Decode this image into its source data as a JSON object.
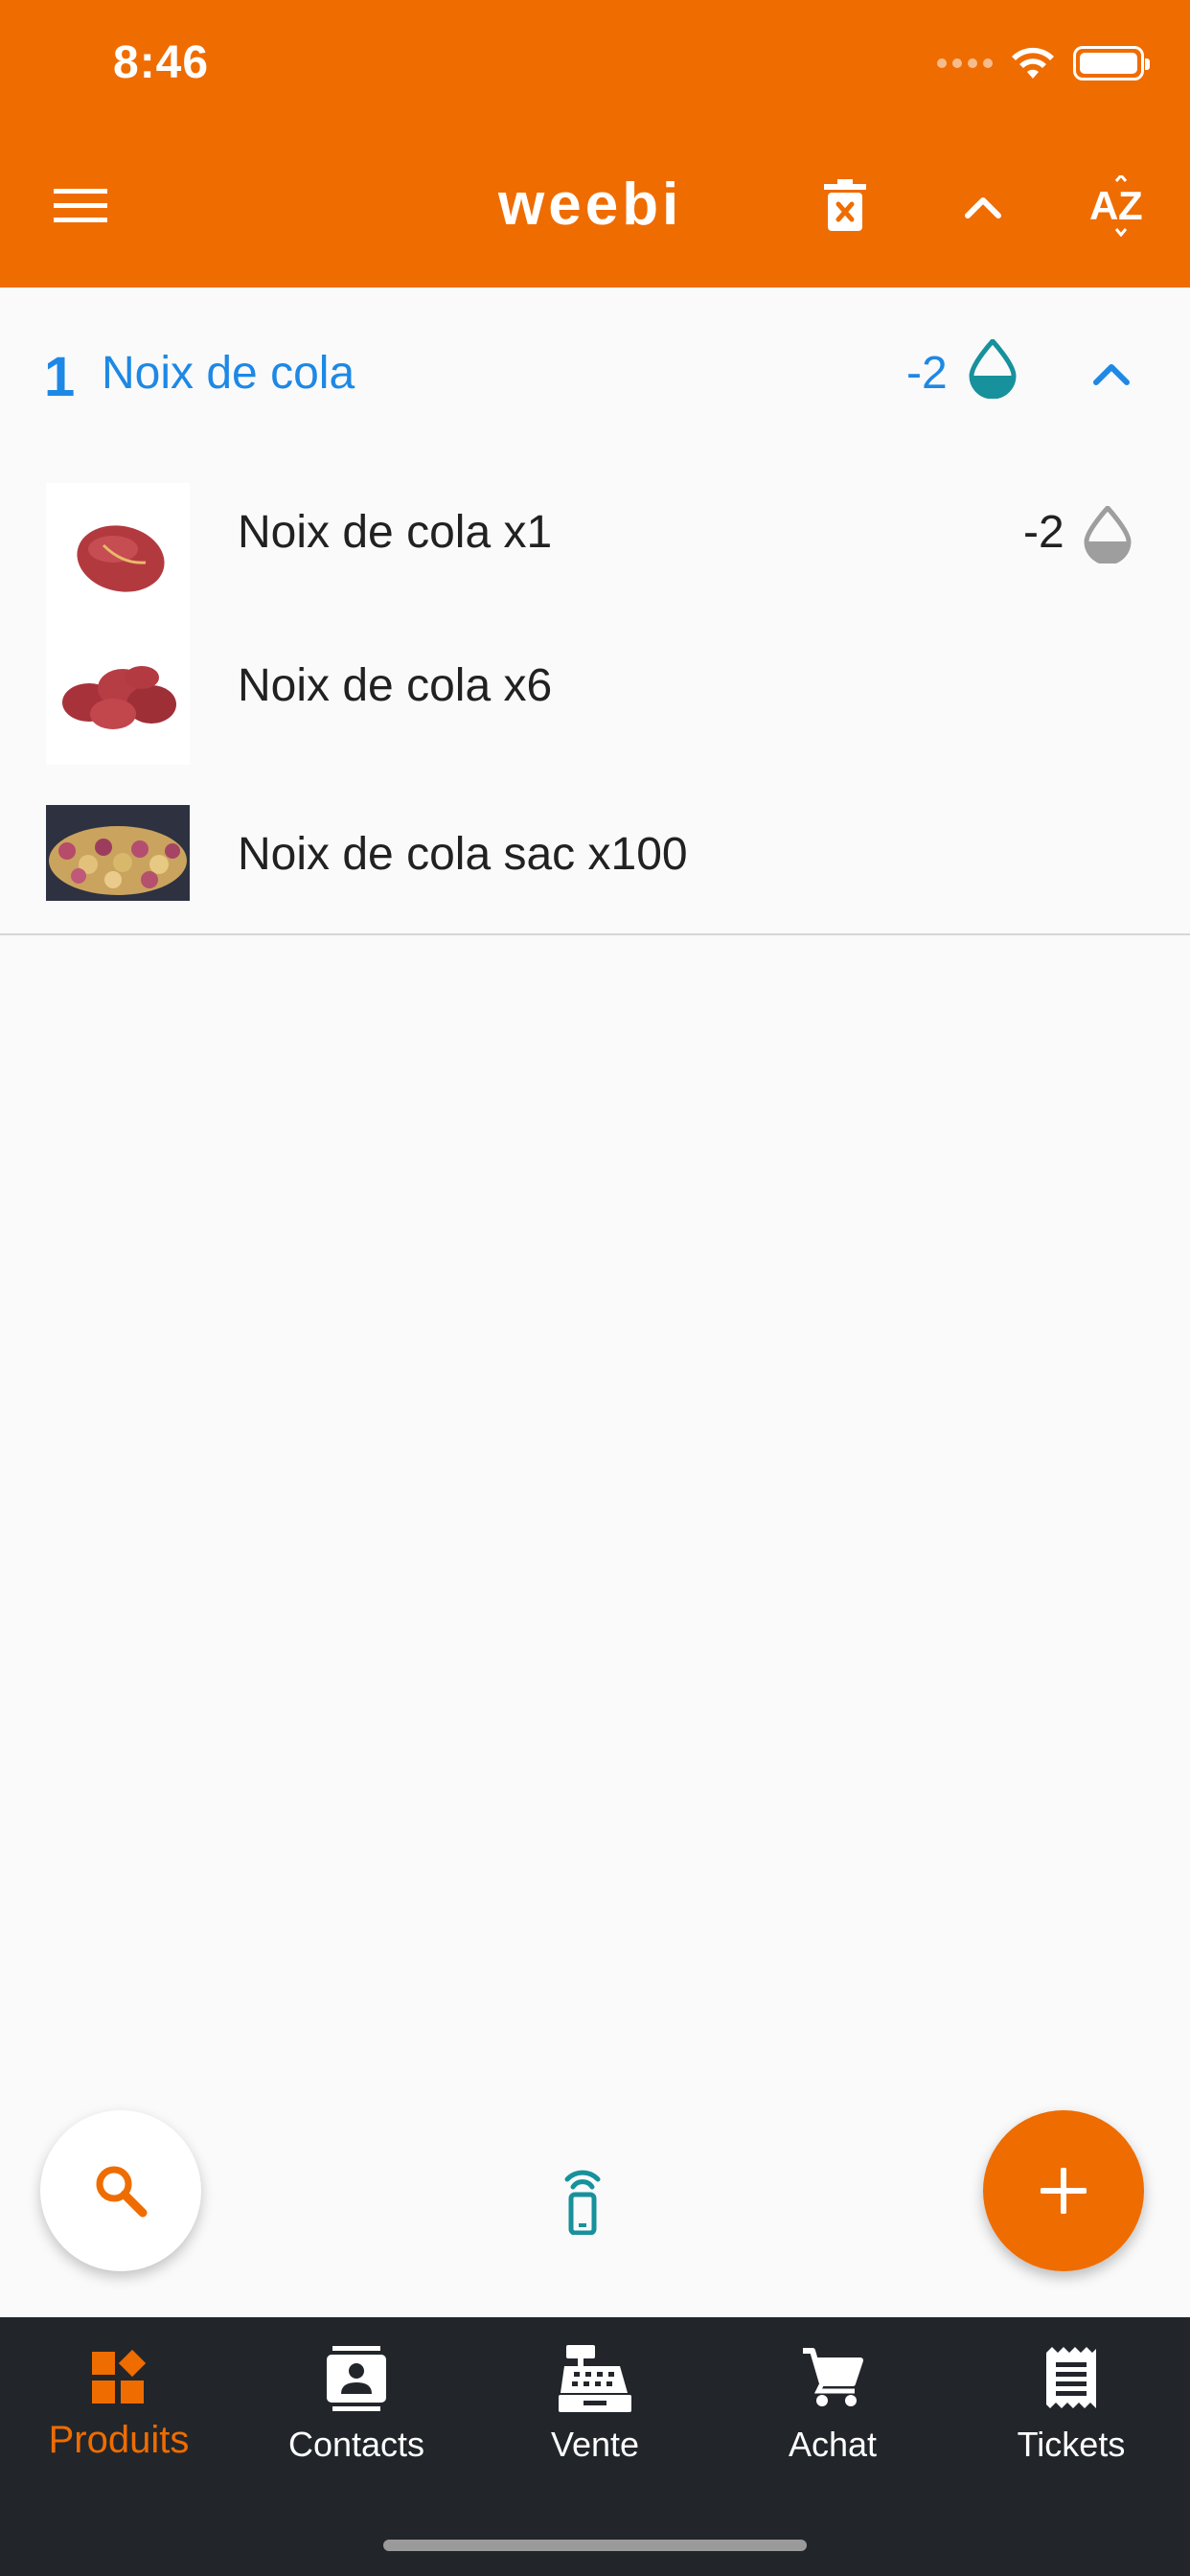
{
  "status_bar": {
    "time": "8:46"
  },
  "app_bar": {
    "title": "weebi"
  },
  "group": {
    "index": "1",
    "title": "Noix de cola",
    "stock": "-2"
  },
  "products": [
    {
      "name": "Noix de cola x1",
      "stock": "-2"
    },
    {
      "name": "Noix de cola x6",
      "stock": ""
    },
    {
      "name": "Noix de cola sac x100",
      "stock": ""
    }
  ],
  "bottom_nav": {
    "items": [
      {
        "label": "Produits",
        "icon": "products-icon",
        "active": true
      },
      {
        "label": "Contacts",
        "icon": "contacts-icon",
        "active": false
      },
      {
        "label": "Vente",
        "icon": "cash-register-icon",
        "active": false
      },
      {
        "label": "Achat",
        "icon": "cart-icon",
        "active": false
      },
      {
        "label": "Tickets",
        "icon": "receipt-icon",
        "active": false
      }
    ]
  },
  "colors": {
    "primary": "#ef6c00",
    "accent_blue": "#1e88e5",
    "teal": "#17919b",
    "nav_background": "#22262b"
  }
}
